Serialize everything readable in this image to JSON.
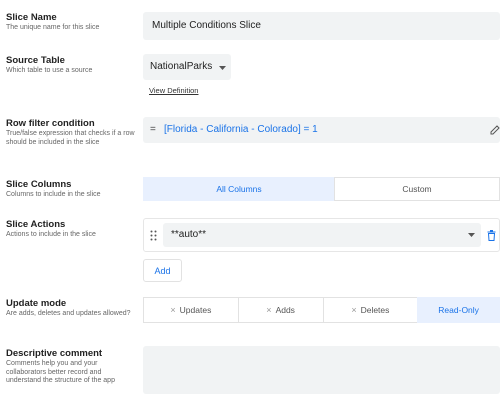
{
  "slice_name": {
    "label": "Slice Name",
    "desc": "The unique name for this slice",
    "value": "Multiple Conditions Slice"
  },
  "source_table": {
    "label": "Source Table",
    "desc": "Which table to use a source",
    "value": "NationalParks",
    "view_definition": "View Definition"
  },
  "row_filter": {
    "label": "Row filter condition",
    "desc": "True/false expression that checks if a row should be included in the slice",
    "eq": "=",
    "expression": "[Florida - California - Colorado] = 1"
  },
  "slice_columns": {
    "label": "Slice Columns",
    "desc": "Columns to include in the slice",
    "options": [
      "All Columns",
      "Custom"
    ],
    "selected": "All Columns"
  },
  "slice_actions": {
    "label": "Slice Actions",
    "desc": "Actions to include in the slice",
    "value": "**auto**",
    "add_label": "Add"
  },
  "update_mode": {
    "label": "Update mode",
    "desc": "Are adds, deletes and updates allowed?",
    "options": [
      "Updates",
      "Adds",
      "Deletes",
      "Read-Only"
    ],
    "selected": "Read-Only"
  },
  "descriptive_comment": {
    "label": "Descriptive comment",
    "desc": "Comments help you and your collaborators better record and understand the structure of the app",
    "value": ""
  },
  "colors": {
    "accent": "#1a73e8",
    "selected_bg": "#e8f0fe",
    "field_bg": "#f1f3f4"
  }
}
